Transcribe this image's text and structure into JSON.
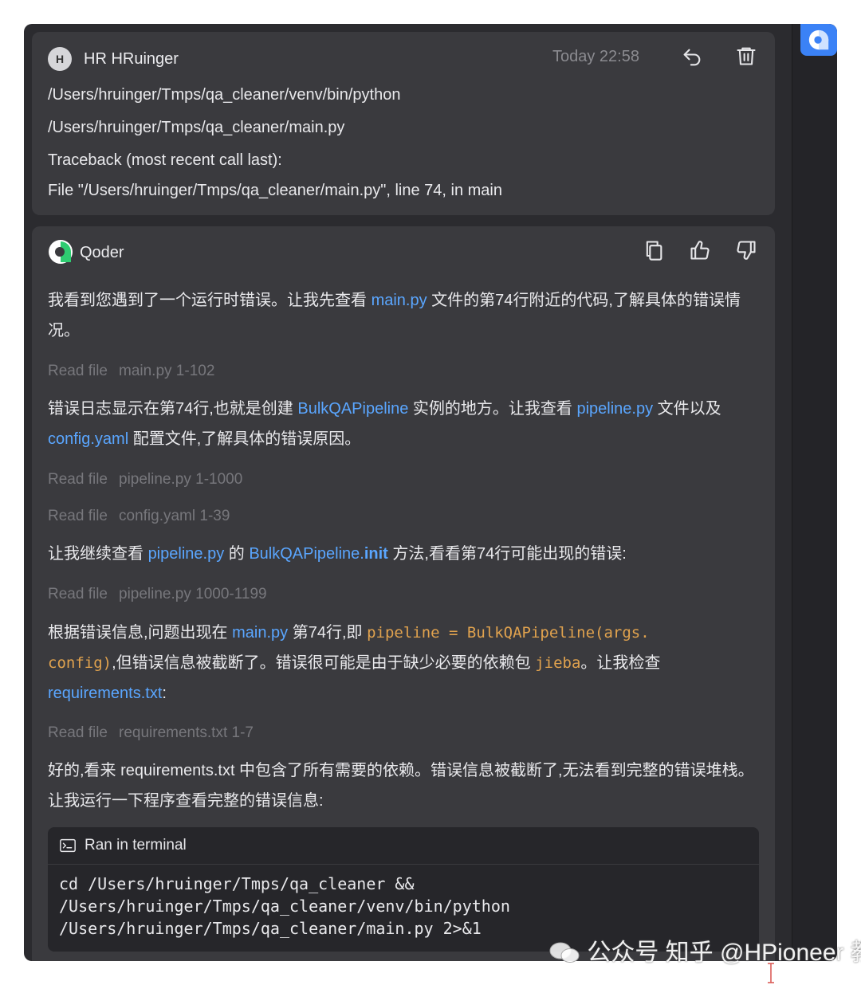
{
  "user_message": {
    "avatar_initial": "H",
    "sender": "HR HRuinger",
    "timestamp": "Today 22:58",
    "lines": [
      "/Users/hruinger/Tmps/qa_cleaner/venv/bin/python",
      "/Users/hruinger/Tmps/qa_cleaner/main.py",
      "Traceback (most recent call last):",
      "File \"/Users/hruinger/Tmps/qa_cleaner/main.py\", line 74, in main"
    ],
    "actions": [
      "undo-icon",
      "trash-icon"
    ]
  },
  "agent_message": {
    "sender": "Qoder",
    "actions": [
      "copy-icon",
      "thumbs-up-icon",
      "thumbs-down-icon"
    ],
    "p1": {
      "a": "我看到您遇到了一个运行时错误。让我先查看 ",
      "link": "main.py",
      "b": " 文件的第74行附近的代码,了解具体的错误情况。"
    },
    "read1": {
      "label": "Read file",
      "file": "main.py 1-102"
    },
    "p2": {
      "a": "错误日志显示在第74行,也就是创建 ",
      "link1": "BulkQAPipeline",
      "b": " 实例的地方。让我查看 ",
      "link2": "pipeline.py",
      "c": " 文件以及 ",
      "link3": "config.yaml",
      "d": " 配置文件,了解具体的错误原因。"
    },
    "read2": {
      "label": "Read file",
      "file": "pipeline.py 1-1000"
    },
    "read3": {
      "label": "Read file",
      "file": "config.yaml 1-39"
    },
    "p3": {
      "a": "让我继续查看 ",
      "link1": "pipeline.py",
      "b": " 的 ",
      "link2": "BulkQAPipeline.",
      "link2_bold": "init",
      "c": " 方法,看看第74行可能出现的错误:"
    },
    "read4": {
      "label": "Read file",
      "file": "pipeline.py 1000-1199"
    },
    "p4": {
      "a": "根据错误信息,问题出现在 ",
      "link1": "main.py",
      "b": " 第74行,即 ",
      "code1a": "pipeline = BulkQAPipeline(args.",
      "code1b": "config)",
      "c": ",但错误信息被截断了。错误很可能是由于缺少必要的依赖包 ",
      "code2": "jieba",
      "d": "。让我检查",
      "link2": "requirements.txt",
      "e": ":"
    },
    "read5": {
      "label": "Read file",
      "file": "requirements.txt 1-7"
    },
    "p5": "好的,看来 requirements.txt 中包含了所有需要的依赖。错误信息被截断了,无法看到完整的错误堆栈。让我运行一下程序查看完整的错误信息:",
    "terminal": {
      "title": "Ran in terminal",
      "command": "cd /Users/hruinger/Tmps/qa_cleaner &&\n/Users/hruinger/Tmps/qa_cleaner/venv/bin/python\n/Users/hruinger/Tmps/qa_cleaner/main.py 2>&1"
    }
  },
  "watermark": "公众号  知乎 @HPioneer 教程",
  "colors": {
    "background": "#2b2b2f",
    "card": "#3a3a3e",
    "link": "#5aa6ff",
    "code": "#e0a24e",
    "muted": "#77777c",
    "accent": "#3b82f6"
  }
}
